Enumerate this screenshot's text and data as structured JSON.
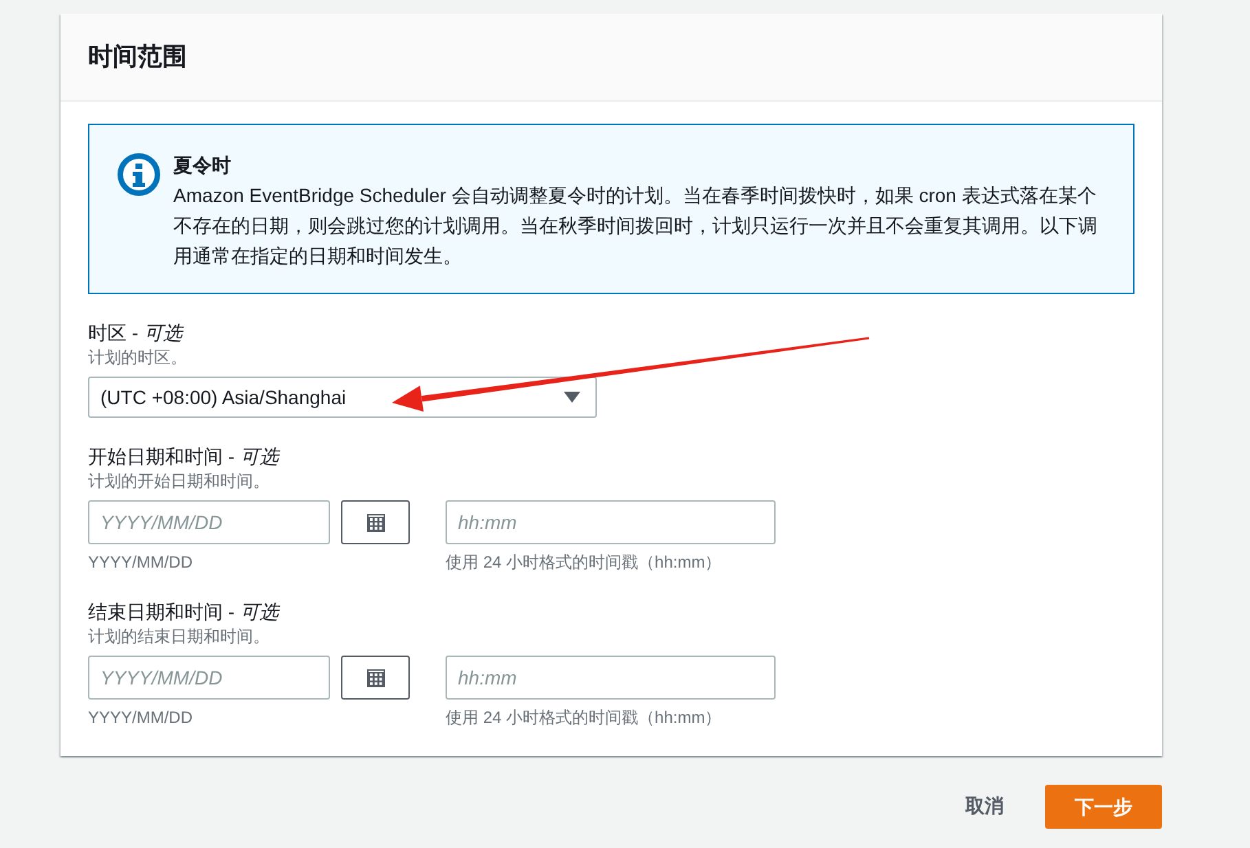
{
  "section": {
    "title": "时间范围"
  },
  "alert": {
    "title": "夏令时",
    "text": "Amazon EventBridge Scheduler 会自动调整夏令时的计划。当在春季时间拨快时，如果 cron 表达式落在某个不存在的日期，则会跳过您的计划调用。当在秋季时间拨回时，计划只运行一次并且不会重复其调用。以下调用通常在指定的日期和时间发生。"
  },
  "fields": [
    {
      "kind": "select",
      "label": "时区 - *可选*",
      "description": "计划的时区。",
      "value": "(UTC +08:00) Asia/Shanghai"
    },
    {
      "kind": "datetime",
      "label": "开始日期和时间 - *可选*",
      "description": "计划的开始日期和时间。",
      "date": {
        "placeholder": "YYYY/MM/DD",
        "hint": "YYYY/MM/DD"
      },
      "time": {
        "placeholder": "hh:mm",
        "hint": "使用 24 小时格式的时间戳（hh:mm）"
      }
    },
    {
      "kind": "datetime",
      "label": "结束日期和时间 - *可选*",
      "description": "计划的结束日期和时间。",
      "date": {
        "placeholder": "YYYY/MM/DD",
        "hint": "YYYY/MM/DD"
      },
      "time": {
        "placeholder": "hh:mm",
        "hint": "使用 24 小时格式的时间戳（hh:mm）"
      }
    }
  ],
  "actions": [
    {
      "kind": "link",
      "label": "取消"
    },
    {
      "kind": "primary",
      "label": "下一步"
    }
  ]
}
